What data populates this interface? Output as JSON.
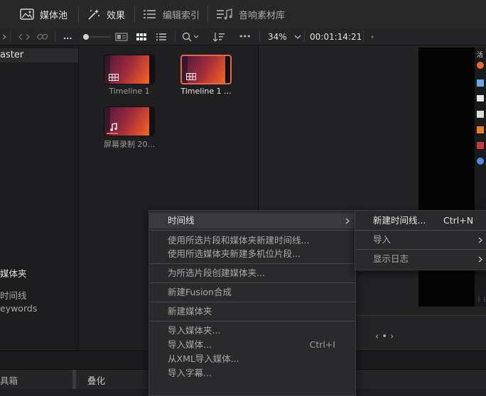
{
  "toolbar": {
    "media_pool_label": "媒体池",
    "effects_label": "效果",
    "edit_index_label": "编辑索引",
    "sound_library_label": "音响素材库"
  },
  "toolbar2": {
    "more_dots_left": "...",
    "more_dots": "•••",
    "zoom": "34%",
    "timecode": "00:01:14:21"
  },
  "bins": {
    "master_label": "aster",
    "section_title": "媒体夹",
    "items": [
      "时间线",
      "eywords"
    ]
  },
  "pool": {
    "clips": [
      {
        "label": "Timeline 1",
        "type": "timeline",
        "selected": false
      },
      {
        "label": "Timeline 1 ...",
        "type": "timeline",
        "selected": true
      },
      {
        "label": "屏幕录制 20...",
        "type": "audio-video",
        "selected": false
      }
    ]
  },
  "viewer": {
    "side_badge": "活",
    "page_dots": "‹ • ›"
  },
  "bottom": {
    "toolbox_label": "具箱",
    "overlay_label": "叠化"
  },
  "context_menu": {
    "items": [
      {
        "label": "时间线",
        "has_submenu": true,
        "highlighted": true
      },
      {
        "label": "使用所选片段和媒体夹新建时间线..."
      },
      {
        "label": "使用所选媒体夹新建多机位片段..."
      },
      {
        "label": "为所选片段创建媒体夹..."
      },
      {
        "label": "新建Fusion合成"
      },
      {
        "label": "新建媒体夹"
      },
      {
        "label": "导入媒体夹..."
      },
      {
        "label": "导入媒体...",
        "shortcut": "Ctrl+I"
      },
      {
        "label": "从XML导入媒体..."
      },
      {
        "label": "导入字幕..."
      }
    ]
  },
  "submenu": {
    "items": [
      {
        "label": "新建时间线...",
        "shortcut": "Ctrl+N"
      },
      {
        "label": "导入",
        "has_submenu": true
      },
      {
        "label": "显示日志",
        "has_submenu": true
      }
    ]
  },
  "colors": {
    "accent": "#e8664a",
    "menu_bg": "#2a2a2d",
    "app_bg": "#1f1f22"
  }
}
